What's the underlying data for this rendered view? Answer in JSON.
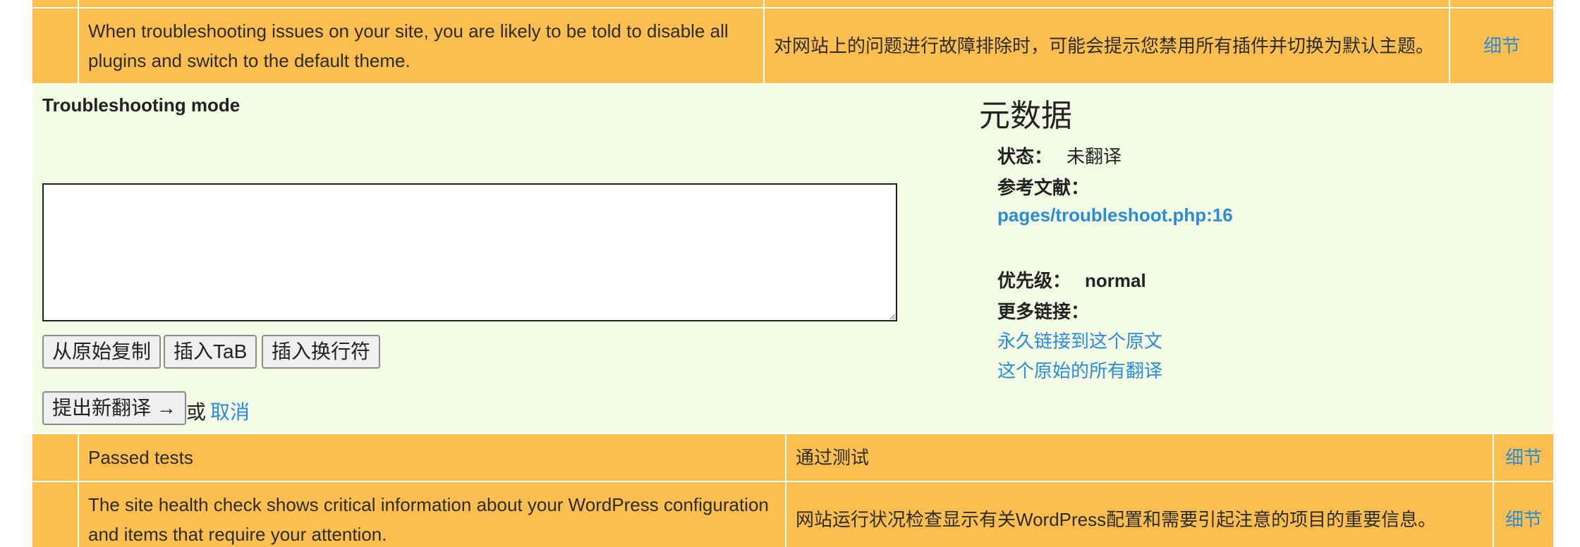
{
  "rows_top": [
    {
      "original": "When troubleshooting issues on your site, you are likely to be told to disable all plugins and switch to the default theme.",
      "translation": "对网站上的问题进行故障排除时，可能会提示您禁用所有插件并切换为默认主题。",
      "details_label": "细节"
    }
  ],
  "editor": {
    "title": "Troubleshooting mode",
    "textarea_value": "",
    "copy_button": "从原始复制",
    "tab_button": "插入TaB",
    "newline_button": "插入换行符",
    "submit_button": "提出新翻译 →",
    "or_text": "或",
    "cancel_link": "取消"
  },
  "meta": {
    "heading": "元数据",
    "status_label": "状态：",
    "status_value": "未翻译",
    "references_label": "参考文献：",
    "reference_link": "pages/troubleshoot.php:16",
    "priority_label": "优先级：",
    "priority_value": "normal",
    "more_links_label": "更多链接：",
    "permalink": "永久链接到这个原文",
    "all_translations": "这个原始的所有翻译"
  },
  "rows_bottom": [
    {
      "original": "Passed tests",
      "translation": "通过测试",
      "details_label": "细节"
    },
    {
      "original": "The site health check shows critical information about your WordPress configuration and items that require your attention.",
      "translation": "网站运行状况检查显示有关WordPress配置和需要引起注意的项目的重要信息。",
      "details_label": "细节"
    }
  ],
  "colors": {
    "row_bg": "#fcbf4f",
    "editor_bg": "#f3fbe4",
    "link": "#2a8bd7"
  }
}
